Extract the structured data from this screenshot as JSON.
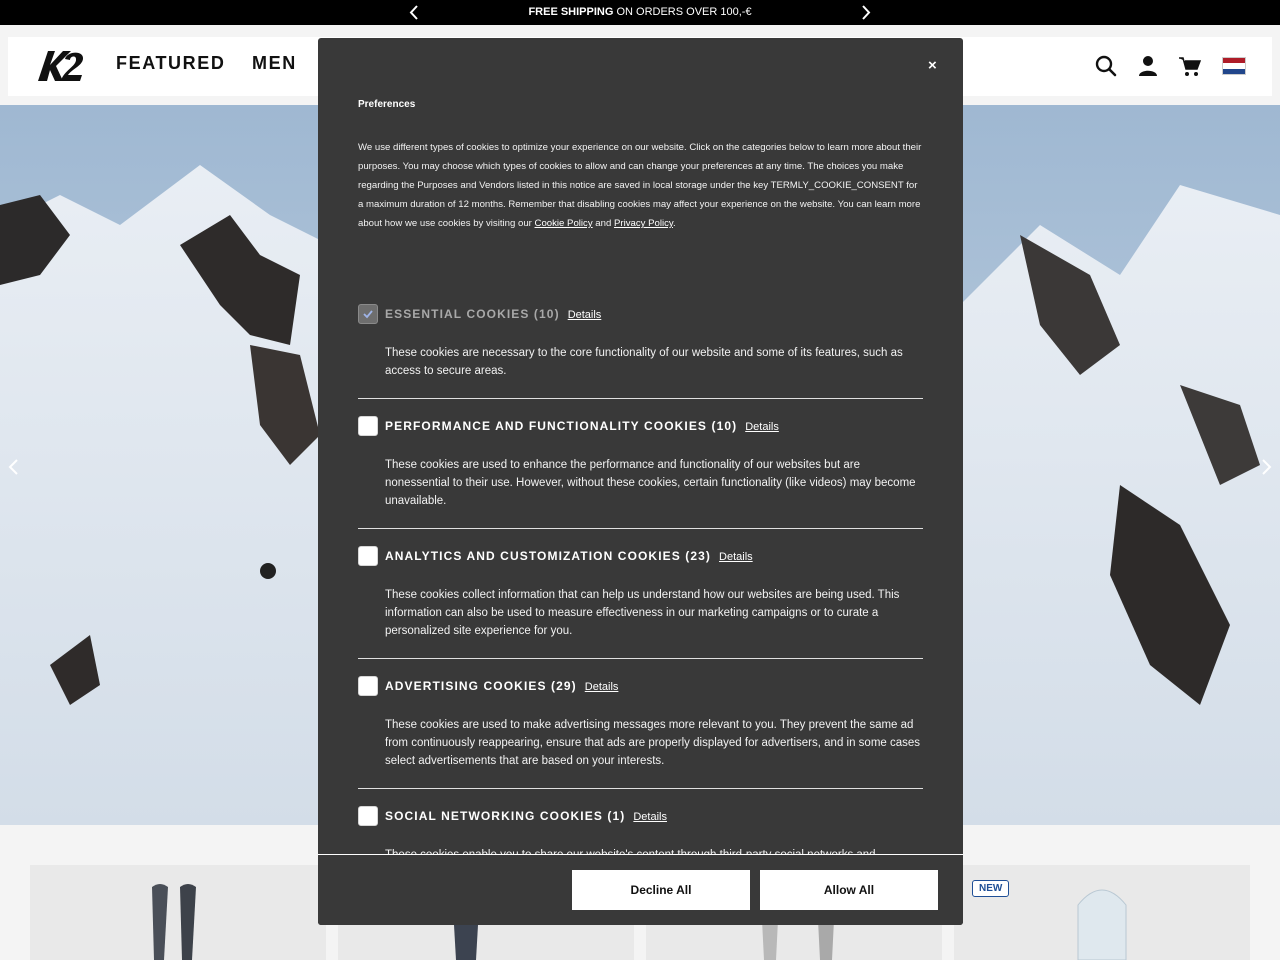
{
  "promo": {
    "bold_text": "FREE SHIPPING",
    "text": " ON ORDERS OVER 100,-€"
  },
  "header": {
    "logo_text": "K2",
    "nav": [
      {
        "label": "FEATURED"
      },
      {
        "label": "MEN"
      }
    ],
    "flag_colors": [
      "#ae1c28",
      "#ffffff",
      "#21468b"
    ]
  },
  "products": {
    "badge": "NEW"
  },
  "modal": {
    "close_label": "×",
    "title": "Preferences",
    "description_pre": "We use different types of cookies to optimize your experience on our website. Click on the categories below to learn more about their purposes. You may choose which types of cookies to allow and can change your preferences at any time. The choices you make regarding the Purposes and Vendors listed in this notice are saved in local storage under the key TERMLY_COOKIE_CONSENT for a maximum duration of 12 months. Remember that disabling cookies may affect your experience on the website. You can learn more about how we use cookies by visiting our ",
    "cookie_policy_link": "Cookie Policy",
    "and_text": " and ",
    "privacy_policy_link": "Privacy Policy",
    "period": ".",
    "details_label": "Details",
    "categories": [
      {
        "title": "ESSENTIAL COOKIES (10)",
        "checked": true,
        "disabled": true,
        "description": "These cookies are necessary to the core functionality of our website and some of its features, such as access to secure areas."
      },
      {
        "title": "PERFORMANCE AND FUNCTIONALITY COOKIES (10)",
        "checked": false,
        "disabled": false,
        "description": "These cookies are used to enhance the performance and functionality of our websites but are nonessential to their use. However, without these cookies, certain functionality (like videos) may become unavailable."
      },
      {
        "title": "ANALYTICS AND CUSTOMIZATION COOKIES (23)",
        "checked": false,
        "disabled": false,
        "description": "These cookies collect information that can help us understand how our websites are being used. This information can also be used to measure effectiveness in our marketing campaigns or to curate a personalized site experience for you."
      },
      {
        "title": "ADVERTISING COOKIES (29)",
        "checked": false,
        "disabled": false,
        "description": "These cookies are used to make advertising messages more relevant to you. They prevent the same ad from continuously reappearing, ensure that ads are properly displayed for advertisers, and in some cases select advertisements that are based on your interests."
      },
      {
        "title": "SOCIAL NETWORKING COOKIES (1)",
        "checked": false,
        "disabled": false,
        "description": "These cookies enable you to share our website's content through third-party social networks and"
      }
    ],
    "decline_label": "Decline All",
    "allow_label": "Allow All"
  }
}
